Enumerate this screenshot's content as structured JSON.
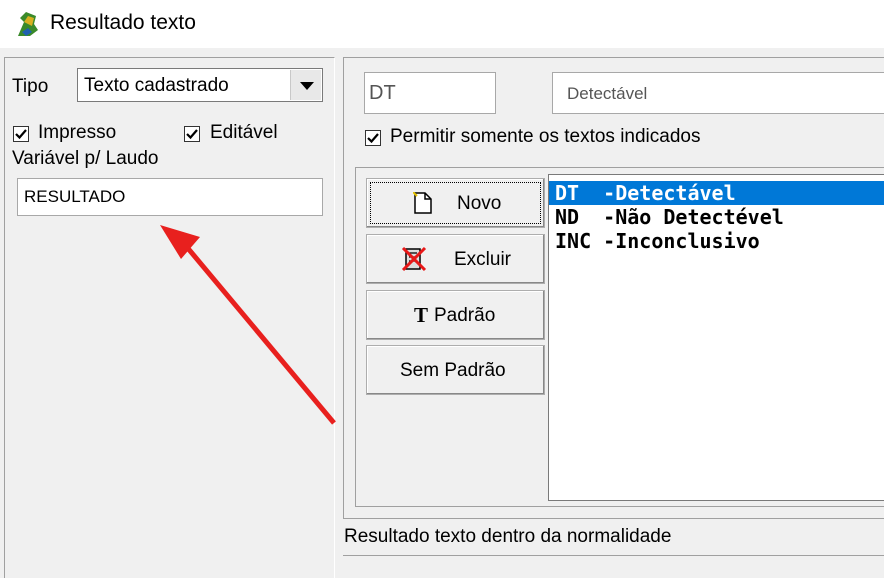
{
  "window": {
    "title": "Resultado texto"
  },
  "left": {
    "tipo_label": "Tipo",
    "tipo_value": "Texto cadastrado",
    "impresso_label": "Impresso",
    "impresso_checked": true,
    "editavel_label": "Editável",
    "editavel_checked": true,
    "variavel_label": "Variável p/ Laudo",
    "variavel_value": "RESULTADO"
  },
  "right": {
    "code_value": "DT",
    "description_value": "Detectável",
    "permitir_label": "Permitir somente os textos indicados",
    "permitir_checked": true,
    "buttons": {
      "novo": "Novo",
      "excluir": "Excluir",
      "padrao": "Padrão",
      "sem_padrao": "Sem Padrão"
    },
    "list": [
      {
        "code": "DT ",
        "text": "-Detectável",
        "selected": true
      },
      {
        "code": "ND ",
        "text": "-Não Detectével",
        "selected": false
      },
      {
        "code": "INC",
        "text": "-Inconclusivo",
        "selected": false
      }
    ],
    "status_label": "Resultado texto dentro da normalidade"
  },
  "colors": {
    "selection": "#0078d7",
    "annotation_arrow": "#e8201e"
  }
}
